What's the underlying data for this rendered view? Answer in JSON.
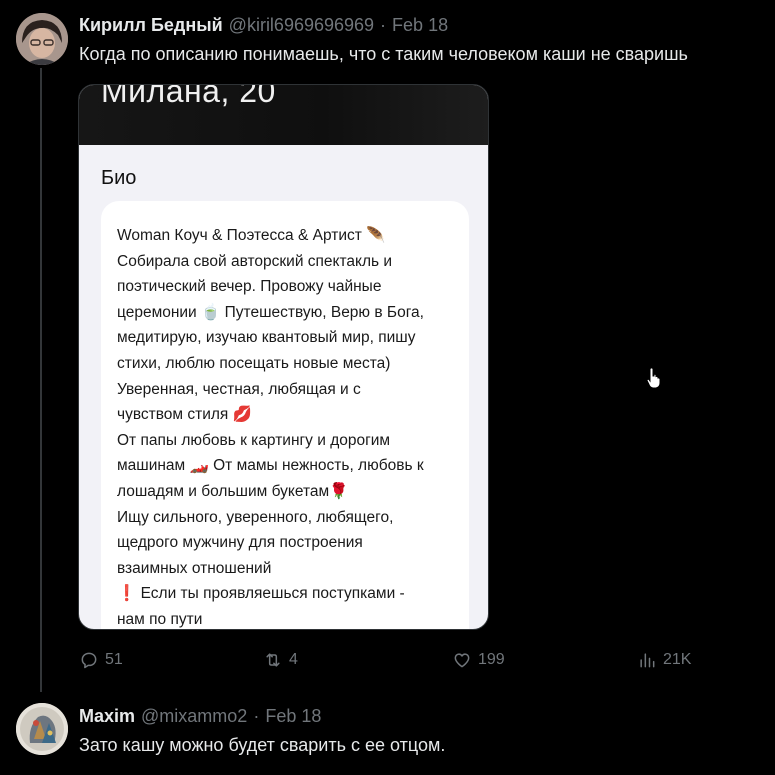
{
  "tweet1": {
    "author": "Кирилл Бедный",
    "handle": "@kiril6969696969",
    "separator": "·",
    "date": "Feb 18",
    "text": "Когда по описанию понимаешь, что с таким человеком каши не сваришь",
    "media": {
      "profile_name": "Милана, 20",
      "section_title": "Био",
      "bio_lines": [
        "Woman Коуч & Поэтесса & Артист 🪶",
        "Собирала свой авторский спектакль и",
        "поэтический вечер. Провожу чайные",
        "церемонии 🍵 Путешествую, Верю в Бога,",
        "медитирую, изучаю квантовый мир, пишу",
        "стихи, люблю посещать новые места)",
        "Уверенная, честная, любящая и с",
        "чувством стиля 💋",
        "От папы любовь к картингу и дорогим",
        "машинам 🏎️  От мамы нежность, любовь к",
        "лошадям и большим букетам🌹",
        "Ищу сильного, уверенного, любящего,",
        "щедрого мужчину для построения",
        "взаимных отношений",
        "❗ Если ты проявляешься поступками -",
        "нам по пути"
      ]
    },
    "actions": {
      "replies": "51",
      "retweets": "4",
      "likes": "199",
      "views": "21K"
    }
  },
  "tweet2": {
    "author": "Maxim",
    "handle": "@mixammo2",
    "separator": "·",
    "date": "Feb 18",
    "text": "Зато кашу можно будет сварить с ее отцом."
  },
  "icons": {
    "reply": "reply-icon",
    "retweet": "retweet-icon",
    "like": "heart-icon",
    "views": "views-icon",
    "cursor": "hand-cursor-icon"
  },
  "colors": {
    "background": "#000000",
    "text_primary": "#e7e9ea",
    "text_secondary": "#71767b",
    "thread_line": "#333639"
  }
}
